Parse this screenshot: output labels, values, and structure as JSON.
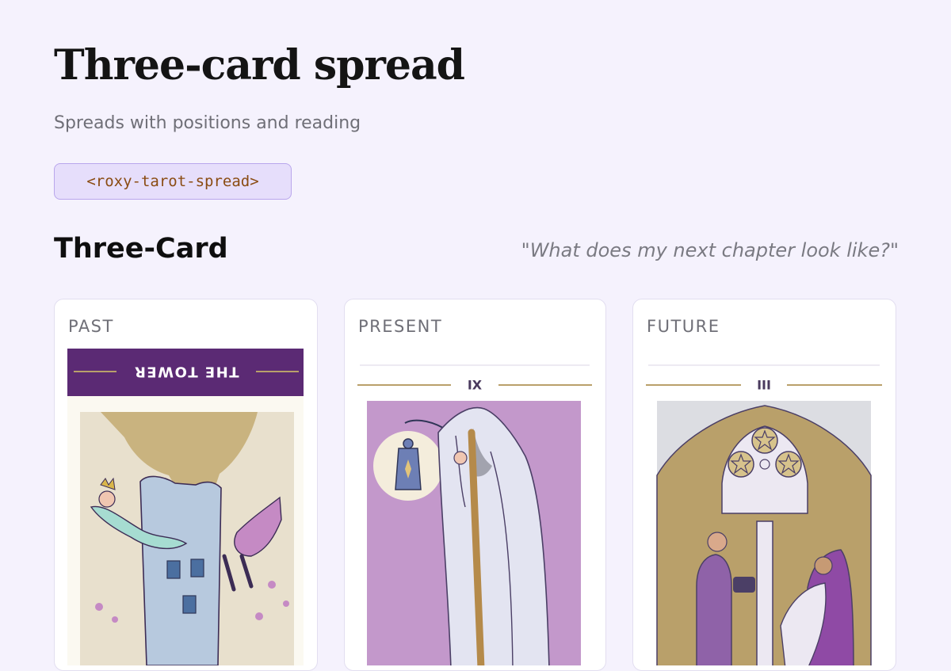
{
  "header": {
    "title": "Three-card spread",
    "subtitle": "Spreads with positions and reading",
    "tag": "<roxy-tarot-spread>"
  },
  "spread": {
    "name": "Three-Card",
    "question": "\"What does my next chapter look like?\""
  },
  "cards": [
    {
      "position": "PAST",
      "card_title": "THE TOWER",
      "reversed": true,
      "accent": "#5b2a74"
    },
    {
      "position": "PRESENT",
      "numeral": "IX",
      "reversed": false,
      "accent": "#c398cb"
    },
    {
      "position": "FUTURE",
      "numeral": "III",
      "reversed": false,
      "accent": "#b9a06a"
    }
  ],
  "colors": {
    "background": "#f5f2fd",
    "chip_bg": "#e6defb",
    "chip_border": "#b9a6ec",
    "chip_text": "#8a4b12"
  }
}
